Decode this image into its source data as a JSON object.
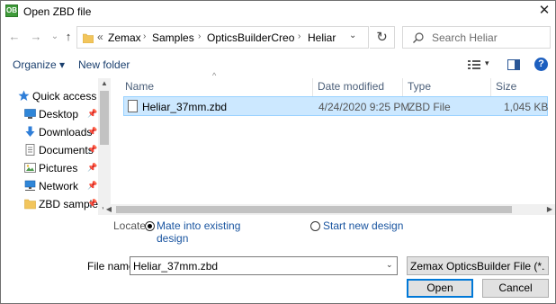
{
  "window": {
    "title": "Open ZBD file",
    "app_icon_text": "OB",
    "close_glyph": "✕"
  },
  "nav": {
    "back_glyph": "←",
    "forward_glyph": "→",
    "recent_glyph": "⌄",
    "up_glyph": "↑"
  },
  "address": {
    "overflow": "«",
    "crumbs": [
      "Zemax",
      "Samples",
      "OpticsBuilderCreo",
      "Heliar"
    ],
    "separator": "›",
    "dropdown_glyph": "⌄"
  },
  "refresh_glyph": "↻",
  "search": {
    "placeholder": "Search Heliar"
  },
  "toolbar": {
    "organize_label": "Organize ▾",
    "new_folder_label": "New folder",
    "help_glyph": "?",
    "view_dd_glyph": "▾"
  },
  "sidebar": {
    "items": [
      {
        "label": "Quick access",
        "icon": "star-icon",
        "pinned": false
      },
      {
        "label": "Desktop",
        "icon": "desktop-icon",
        "pinned": true
      },
      {
        "label": "Downloads",
        "icon": "download-icon",
        "pinned": true
      },
      {
        "label": "Documents",
        "icon": "documents-icon",
        "pinned": true
      },
      {
        "label": "Pictures",
        "icon": "pictures-icon",
        "pinned": true
      },
      {
        "label": "Network",
        "icon": "network-icon",
        "pinned": true
      },
      {
        "label": "ZBD sample",
        "icon": "folder-icon",
        "pinned": true
      }
    ],
    "pin_glyph": "📌"
  },
  "files": {
    "columns": [
      "Name",
      "Date modified",
      "Type",
      "Size"
    ],
    "rows": [
      {
        "name": "Heliar_37mm.zbd",
        "date": "4/24/2020 9:25 PM",
        "type": "ZBD File",
        "size": "1,045 KB"
      }
    ]
  },
  "locate": {
    "label": "Locate:",
    "options": [
      {
        "line1": "Mate into existing",
        "line2": "design",
        "checked": true
      },
      {
        "line1": "Start new design",
        "line2": "",
        "checked": false
      }
    ]
  },
  "bottom": {
    "filename_label": "File name:",
    "filename_value": "Heliar_37mm.zbd",
    "filter_value": "Zemax OpticsBuilder File (*.zbd",
    "open_label": "Open",
    "cancel_label": "Cancel"
  },
  "colors": {
    "selection_bg": "#cce8ff",
    "selection_border": "#99d1ff",
    "link_blue": "#1a55a0",
    "default_button": "#0078d7"
  }
}
